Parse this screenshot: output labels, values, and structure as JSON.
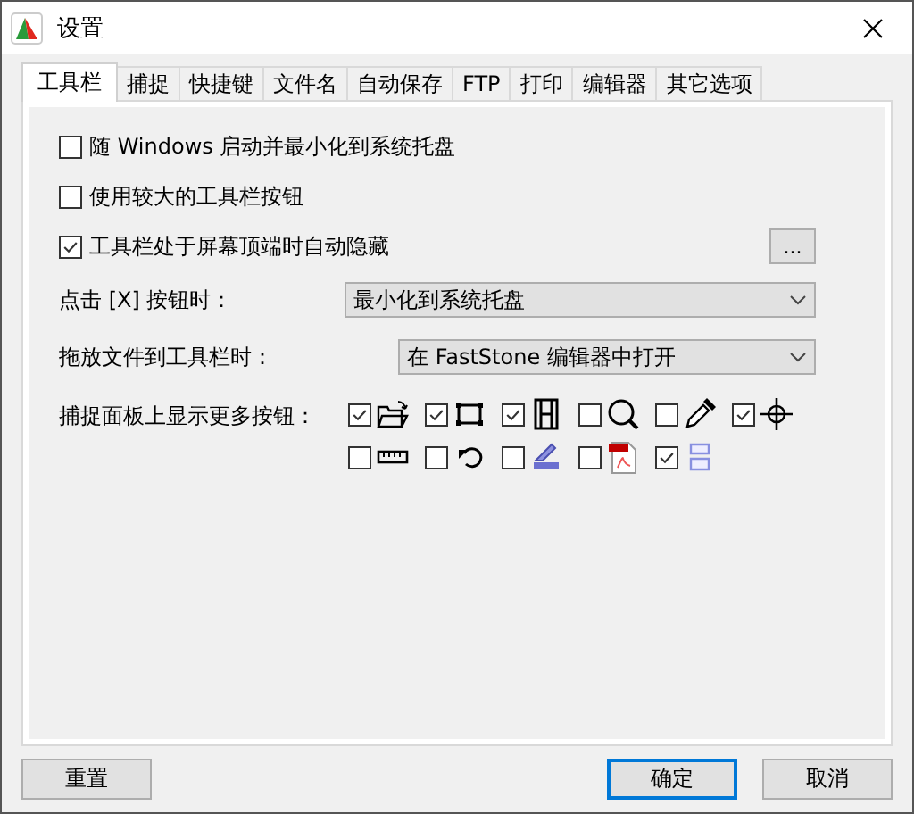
{
  "window": {
    "title": "设置"
  },
  "tabs": [
    {
      "label": "工具栏",
      "selected": true
    },
    {
      "label": "捕捉",
      "selected": false
    },
    {
      "label": "快捷键",
      "selected": false
    },
    {
      "label": "文件名",
      "selected": false
    },
    {
      "label": "自动保存",
      "selected": false
    },
    {
      "label": "FTP",
      "selected": false
    },
    {
      "label": "打印",
      "selected": false
    },
    {
      "label": "编辑器",
      "selected": false
    },
    {
      "label": "其它选项",
      "selected": false
    }
  ],
  "options": [
    {
      "label": "随 Windows 启动并最小化到系统托盘",
      "checked": false
    },
    {
      "label": "使用较大的工具栏按钮",
      "checked": false
    },
    {
      "label": "工具栏处于屏幕顶端时自动隐藏",
      "checked": true
    }
  ],
  "more_button": "...",
  "dropdowns": [
    {
      "label": "点击 [X] 按钮时：",
      "value": "最小化到系统托盘"
    },
    {
      "label": "拖放文件到工具栏时：",
      "value": "在 FastStone 编辑器中打开"
    }
  ],
  "capture_buttons": {
    "label": "捕捉面板上显示更多按钮：",
    "items": [
      {
        "kind": "folder",
        "checked": true
      },
      {
        "kind": "region",
        "checked": true
      },
      {
        "kind": "film",
        "checked": true
      },
      {
        "kind": "magnifier",
        "checked": false
      },
      {
        "kind": "dropper",
        "checked": false
      },
      {
        "kind": "crosshair",
        "checked": true
      },
      {
        "kind": "ruler",
        "checked": false
      },
      {
        "kind": "arrow",
        "checked": false
      },
      {
        "kind": "scanner",
        "checked": false
      },
      {
        "kind": "pdf",
        "checked": false
      },
      {
        "kind": "panels",
        "checked": true
      }
    ]
  },
  "buttons": [
    {
      "label": "重置",
      "kind": "reset"
    },
    {
      "label": "确定",
      "kind": "default"
    },
    {
      "label": "取消",
      "kind": "normal"
    }
  ]
}
